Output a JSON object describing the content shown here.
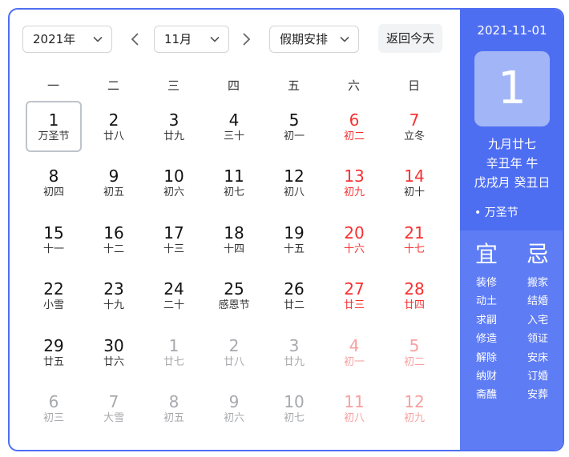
{
  "toolbar": {
    "year": "2021年",
    "month": "11月",
    "holiday": "假期安排",
    "today": "返回今天"
  },
  "weekdays": [
    "一",
    "二",
    "三",
    "四",
    "五",
    "六",
    "日"
  ],
  "days": [
    {
      "n": "1",
      "l": "万圣节"
    },
    {
      "n": "2",
      "l": "廿八"
    },
    {
      "n": "3",
      "l": "廿九"
    },
    {
      "n": "4",
      "l": "三十"
    },
    {
      "n": "5",
      "l": "初一"
    },
    {
      "n": "6",
      "l": "初二"
    },
    {
      "n": "7",
      "l": "立冬"
    },
    {
      "n": "8",
      "l": "初四"
    },
    {
      "n": "9",
      "l": "初五"
    },
    {
      "n": "10",
      "l": "初六"
    },
    {
      "n": "11",
      "l": "初七"
    },
    {
      "n": "12",
      "l": "初八"
    },
    {
      "n": "13",
      "l": "初九"
    },
    {
      "n": "14",
      "l": "初十"
    },
    {
      "n": "15",
      "l": "十一"
    },
    {
      "n": "16",
      "l": "十二"
    },
    {
      "n": "17",
      "l": "十三"
    },
    {
      "n": "18",
      "l": "十四"
    },
    {
      "n": "19",
      "l": "十五"
    },
    {
      "n": "20",
      "l": "十六"
    },
    {
      "n": "21",
      "l": "十七"
    },
    {
      "n": "22",
      "l": "小雪"
    },
    {
      "n": "23",
      "l": "十九"
    },
    {
      "n": "24",
      "l": "二十"
    },
    {
      "n": "25",
      "l": "感恩节"
    },
    {
      "n": "26",
      "l": "廿二"
    },
    {
      "n": "27",
      "l": "廿三"
    },
    {
      "n": "28",
      "l": "廿四"
    },
    {
      "n": "29",
      "l": "廿五"
    },
    {
      "n": "30",
      "l": "廿六"
    },
    {
      "n": "1",
      "l": "廿七"
    },
    {
      "n": "2",
      "l": "廿八"
    },
    {
      "n": "3",
      "l": "廿九"
    },
    {
      "n": "4",
      "l": "初一"
    },
    {
      "n": "5",
      "l": "初二"
    },
    {
      "n": "6",
      "l": "初三"
    },
    {
      "n": "7",
      "l": "大雪"
    },
    {
      "n": "8",
      "l": "初五"
    },
    {
      "n": "9",
      "l": "初六"
    },
    {
      "n": "10",
      "l": "初七"
    },
    {
      "n": "11",
      "l": "初八"
    },
    {
      "n": "12",
      "l": "初九"
    }
  ],
  "panel": {
    "date": "2021-11-01",
    "day": "1",
    "lunar": "九月廿七",
    "year_gz": "辛丑年 牛",
    "month_day_gz": "戊戌月 癸丑日",
    "festival": "• 万圣节",
    "yi_label": "宜",
    "ji_label": "忌",
    "yi": [
      "装修",
      "动土",
      "求嗣",
      "修造",
      "解除",
      "纳财",
      "斋醮"
    ],
    "ji": [
      "搬家",
      "结婚",
      "入宅",
      "领证",
      "安床",
      "订婚",
      "安葬"
    ]
  }
}
